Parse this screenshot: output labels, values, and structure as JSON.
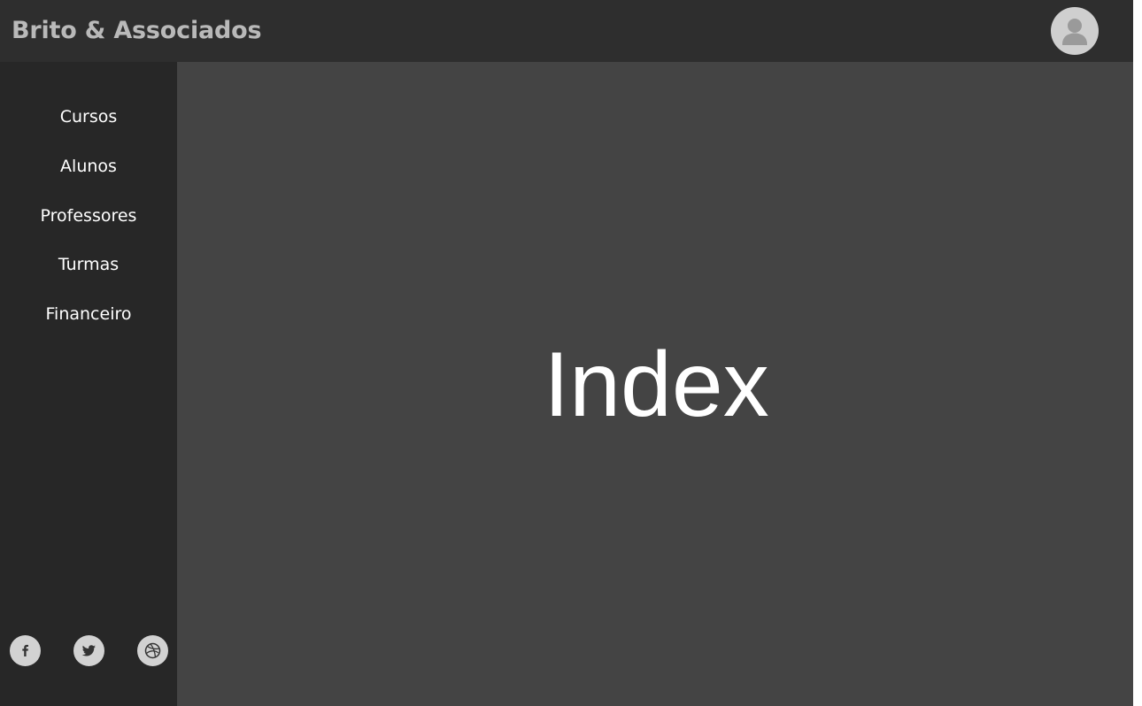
{
  "header": {
    "brand": "Brito & Associados",
    "avatar_icon": "user-avatar-icon"
  },
  "sidebar": {
    "items": [
      {
        "label": "Cursos"
      },
      {
        "label": "Alunos"
      },
      {
        "label": "Professores"
      },
      {
        "label": "Turmas"
      },
      {
        "label": "Financeiro"
      }
    ],
    "social": [
      {
        "icon": "facebook-icon"
      },
      {
        "icon": "twitter-icon"
      },
      {
        "icon": "dribbble-icon"
      }
    ]
  },
  "main": {
    "title": "Index"
  },
  "colors": {
    "header_bg": "#2e2e2e",
    "sidebar_bg": "#272727",
    "main_bg": "#444444",
    "brand_text": "#b9b9b9",
    "icon_bg": "#d2d2d2"
  }
}
